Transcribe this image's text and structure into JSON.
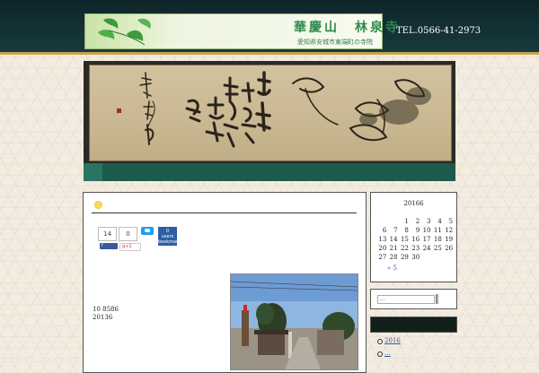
{
  "header": {
    "logo_title": "華慶山　林泉寺",
    "logo_subtitle": "愛知県安城市東端町の寺院",
    "tel": "TEL.0566-41-2973"
  },
  "main": {
    "share": {
      "count_1": "14",
      "count_2": "0",
      "hatena_count": "0",
      "hatena_users": "users",
      "hatena_label": "bookmark",
      "fb_label": "f",
      "gplus_label": "g+1"
    },
    "post_lines": [
      "10 8586",
      "20136"
    ]
  },
  "sidebar": {
    "calendar": {
      "title": "20166",
      "rows": [
        [
          "",
          "",
          "1",
          "2",
          "3",
          "4",
          "5"
        ],
        [
          "6",
          "7",
          "8",
          "9",
          "10",
          "11",
          "12"
        ],
        [
          "13",
          "14",
          "15",
          "16",
          "17",
          "18",
          "19"
        ],
        [
          "20",
          "21",
          "22",
          "23",
          "24",
          "25",
          "26"
        ],
        [
          "27",
          "28",
          "29",
          "30",
          "",
          "",
          ""
        ]
      ],
      "prev_link": "« 5"
    },
    "search": {
      "placeholder": "..."
    },
    "archives": [
      "2016",
      "..."
    ]
  },
  "colors": {
    "header_bg": "#173a3d",
    "gold_accent": "#c9a24a",
    "nav_green": "#1d5b4c",
    "link_blue": "#2b56b0"
  }
}
